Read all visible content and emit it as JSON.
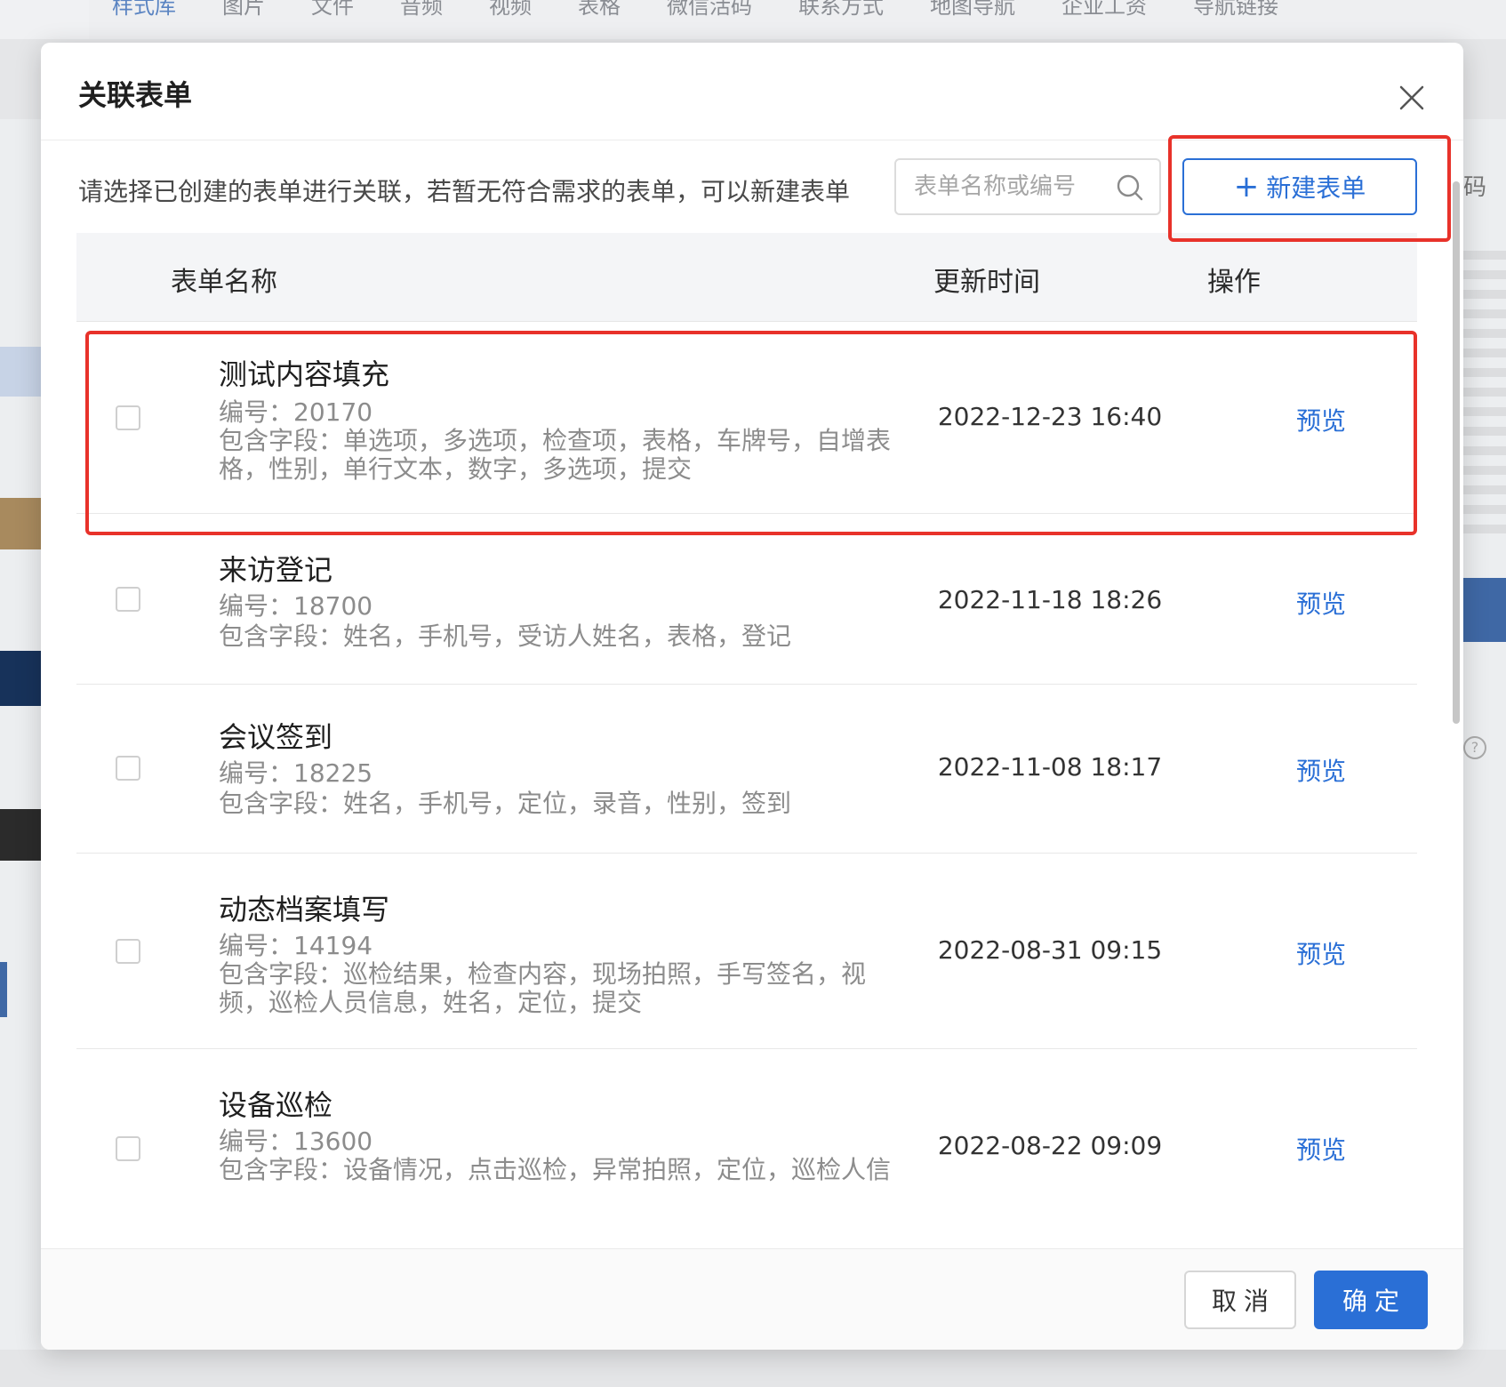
{
  "background": {
    "nav_items": [
      "样式库",
      "图片",
      "文件",
      "音频",
      "视频",
      "表格",
      "微信活码",
      "联系方式",
      "地图导航",
      "企业工资",
      "导航链接"
    ],
    "right_text": "码",
    "help_glyph": "?"
  },
  "modal": {
    "title": "关联表单",
    "description": "请选择已创建的表单进行关联，若暂无符合需求的表单，可以新建表单",
    "search": {
      "placeholder": "表单名称或编号",
      "value": ""
    },
    "new_button": {
      "icon": "+",
      "label": "新建表单"
    },
    "table": {
      "headers": {
        "name": "表单名称",
        "time": "更新时间",
        "action": "操作"
      },
      "rows": [
        {
          "name": "测试内容填充",
          "code": "编号：20170",
          "fields": "包含字段：单选项，多选项，检查项，表格，车牌号，自增表格，性别，单行文本，数字，多选项，提交",
          "time": "2022-12-23 16:40",
          "action": "预览",
          "checked": false
        },
        {
          "name": "来访登记",
          "code": "编号：18700",
          "fields": "包含字段：姓名，手机号，受访人姓名，表格，登记",
          "time": "2022-11-18 18:26",
          "action": "预览",
          "checked": false
        },
        {
          "name": "会议签到",
          "code": "编号：18225",
          "fields": "包含字段：姓名，手机号，定位，录音，性别，签到",
          "time": "2022-11-08 18:17",
          "action": "预览",
          "checked": false
        },
        {
          "name": "动态档案填写",
          "code": "编号：14194",
          "fields": "包含字段：巡检结果，检查内容，现场拍照，手写签名，视频，巡检人员信息，姓名，定位，提交",
          "time": "2022-08-31 09:15",
          "action": "预览",
          "checked": false
        },
        {
          "name": "设备巡检",
          "code": "编号：13600",
          "fields": "包含字段：设备情况，点击巡检，异常拍照，定位，巡检人信",
          "time": "2022-08-22 09:09",
          "action": "预览",
          "checked": false
        }
      ]
    },
    "footer": {
      "cancel": "取消",
      "ok": "确定"
    }
  },
  "colors": {
    "primary": "#2a6fd6",
    "highlight": "#e8322a"
  },
  "icons": {
    "close": "close-icon",
    "search": "search-icon",
    "plus": "plus-icon",
    "help": "help-icon"
  }
}
